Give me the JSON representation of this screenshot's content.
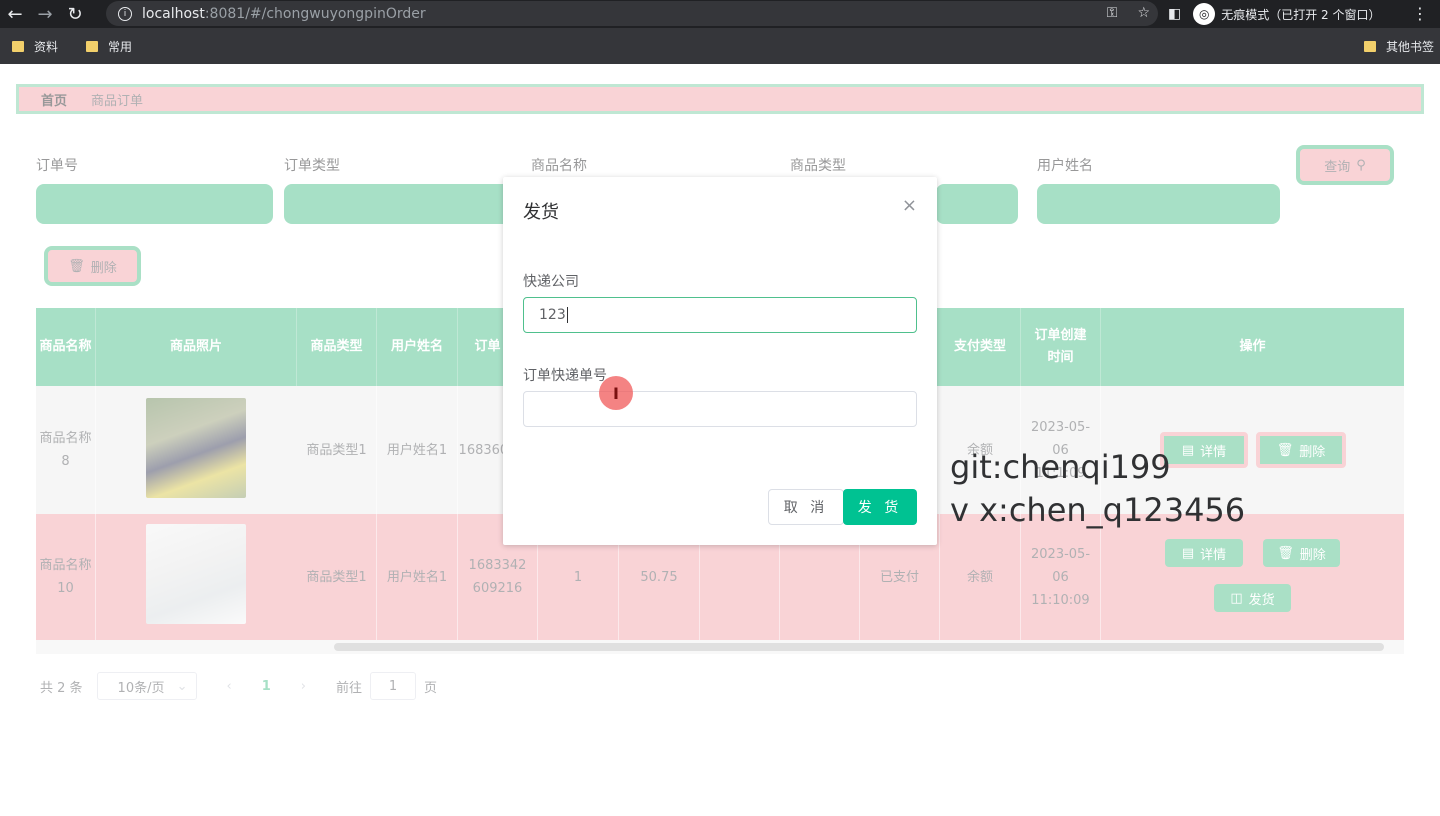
{
  "browser": {
    "url_host": "localhost",
    "url_path": ":8081/#/chongwuyongpinOrder",
    "incognito_label": "无痕模式（已打开 2 个窗口）",
    "bookmarks": [
      "资料",
      "常用"
    ],
    "other_bookmarks": "其他书签",
    "icons": [
      "back-icon",
      "forward-icon",
      "reload-icon",
      "info-icon",
      "key-icon",
      "star-icon",
      "sidepanel-icon",
      "incognito-icon",
      "menu-icon"
    ]
  },
  "breadcrumb": {
    "home": "首页",
    "current": "商品订单"
  },
  "search": {
    "labels": [
      "订单号",
      "订单类型",
      "商品名称",
      "商品类型",
      "用户姓名"
    ],
    "query_label": "查询"
  },
  "toolbar": {
    "delete_label": "删除"
  },
  "table": {
    "headers": [
      "商品名称",
      "商品照片",
      "商品类型",
      "用户姓名",
      "订单",
      "支付类型",
      "订单创建时间",
      "操作"
    ],
    "rows": [
      {
        "name": "商品名称8",
        "type": "商品类型1",
        "user": "用户姓名1",
        "order_no": "1683609",
        "pay_type": "余额",
        "created": "2023-05-06 11:1:09"
      },
      {
        "name": "商品名称10",
        "type": "商品类型1",
        "user": "用户姓名1",
        "order_no": "1683342609216",
        "qty": "1",
        "price": "50.75",
        "status": "已支付",
        "pay_type": "余额",
        "created": "2023-05-06 11:10:09"
      }
    ],
    "ops": {
      "detail": "详情",
      "delete": "删除",
      "ship": "发货"
    }
  },
  "pager": {
    "total": "共 2 条",
    "page_size": "10条/页",
    "current": "1",
    "goto": "前往",
    "goto_value": "1",
    "page_unit": "页"
  },
  "watermark": {
    "line1": "git:chenqi199",
    "line2": "v x:chen_q123456"
  },
  "dialog": {
    "title": "发货",
    "company_label": "快递公司",
    "company_value": "123",
    "tracking_label": "订单快递单号",
    "tracking_value": "",
    "cancel_label": "取 消",
    "ok_label": "发 货"
  }
}
